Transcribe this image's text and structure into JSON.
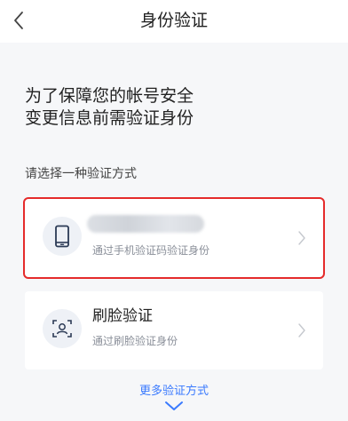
{
  "header": {
    "title": "身份验证",
    "back_icon": "chevron-left-icon"
  },
  "intro": {
    "line1": "为了保障您的帐号安全",
    "line2": "变更信息前需验证身份"
  },
  "select_label": "请选择一种验证方式",
  "methods": [
    {
      "title": "",
      "subtitle": "通过手机验证码验证身份",
      "icon": "phone-icon",
      "highlighted": true,
      "highlight_color": "#e52b2b"
    },
    {
      "title": "刷脸验证",
      "subtitle": "通过刷脸验证身份",
      "icon": "face-scan-icon",
      "highlighted": false
    }
  ],
  "more": {
    "label": "更多验证方式",
    "icon": "chevron-down-icon"
  },
  "colors": {
    "accent": "#3a7afe",
    "highlight": "#e52b2b",
    "icon_bg": "#eef1f6"
  }
}
